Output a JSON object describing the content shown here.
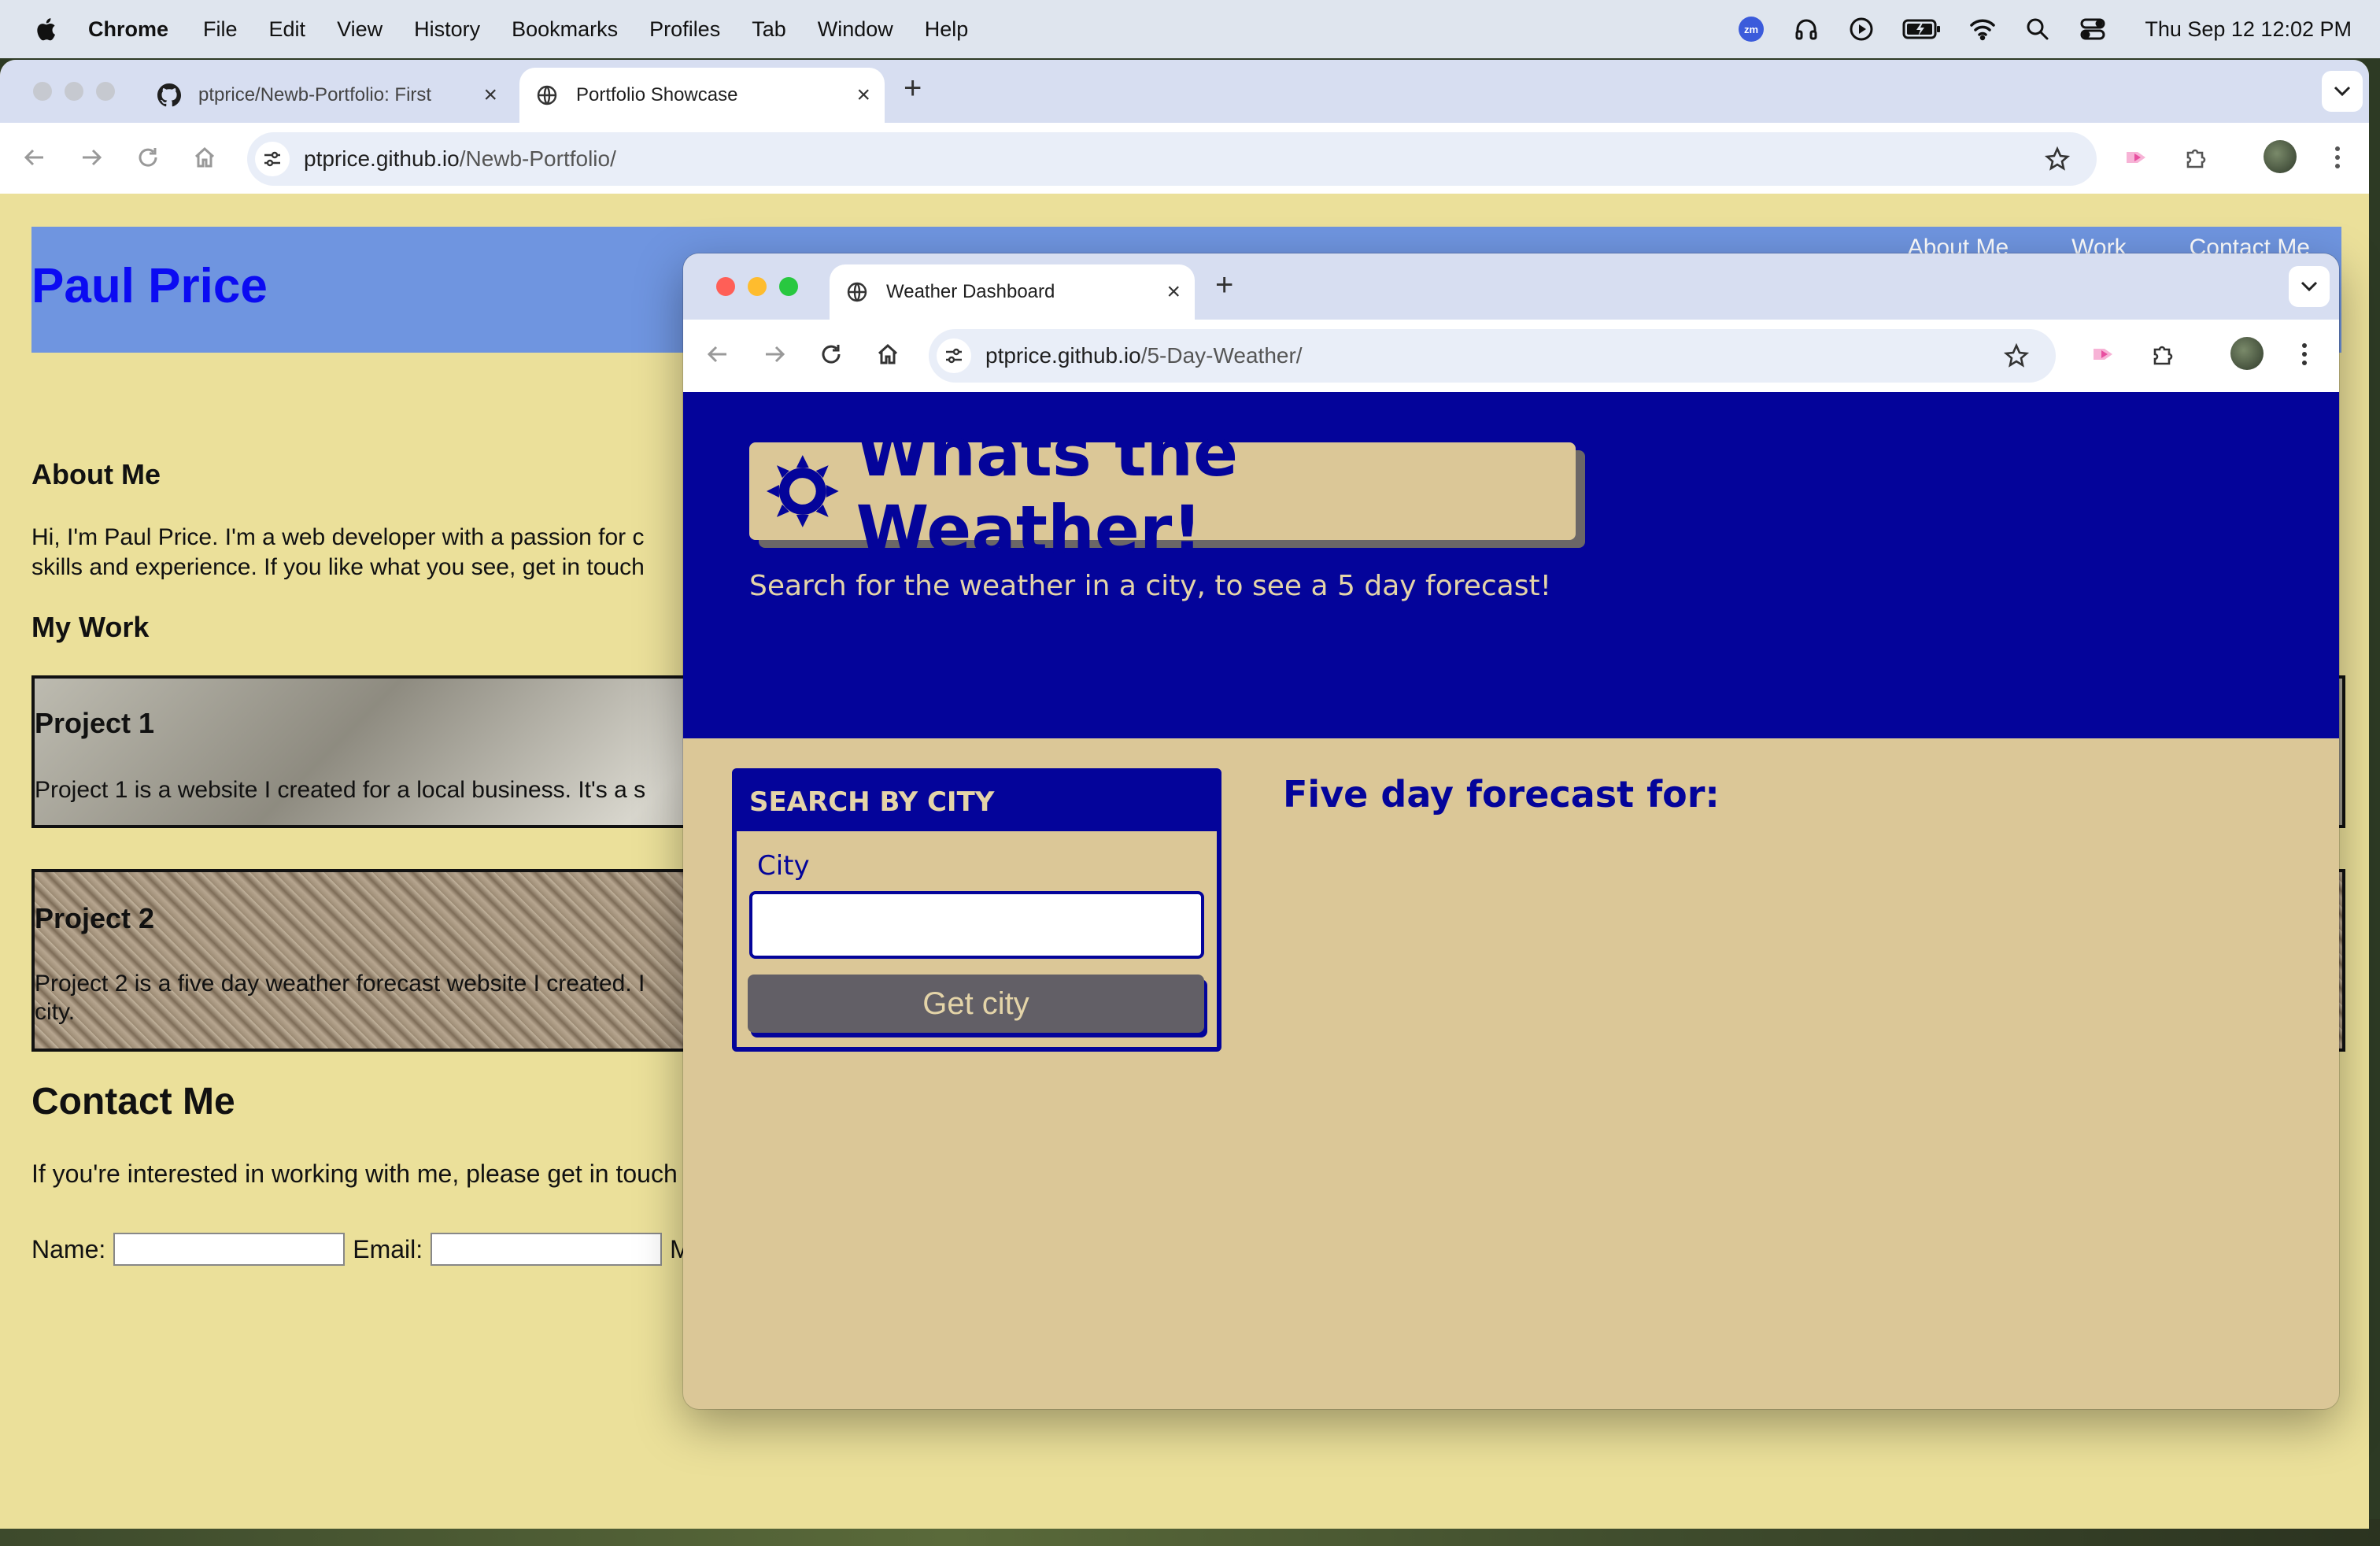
{
  "menubar": {
    "app": "Chrome",
    "items": [
      "File",
      "Edit",
      "View",
      "History",
      "Bookmarks",
      "Profiles",
      "Tab",
      "Window",
      "Help"
    ],
    "clock": "Thu Sep 12  12:02 PM",
    "status_icons": [
      "zoom-icon",
      "headphones-icon",
      "play-icon",
      "battery-icon",
      "wifi-icon",
      "search-icon",
      "control-center-icon"
    ]
  },
  "back_window": {
    "tabs": [
      {
        "title": "ptprice/Newb-Portfolio: First",
        "favicon": "github-icon"
      },
      {
        "title": "Portfolio Showcase",
        "favicon": "globe-icon"
      }
    ],
    "url_host": "ptprice.github.io",
    "url_path": "/Newb-Portfolio/",
    "page": {
      "name": "Paul Price",
      "nav": [
        "About Me",
        "Work",
        "Contact Me"
      ],
      "about_heading": "About Me",
      "about_line1": "Hi, I'm Paul Price. I'm a web developer with a passion for c",
      "about_line2": "skills and experience. If you like what you see, get in touch",
      "work_heading": "My Work",
      "projects": [
        {
          "title": "Project 1",
          "desc": "Project 1 is a website I created for a local business. It's a s"
        },
        {
          "title": "Project 2",
          "desc": "Project 2 is a five day weather forecast website I created. I",
          "desc2": "city."
        }
      ],
      "contact_heading": "Contact Me",
      "contact_text": "If you're interested in working with me, please get in touch",
      "form": {
        "name_label": "Name:",
        "email_label": "Email:",
        "message_label_partial": "M"
      }
    }
  },
  "front_window": {
    "tab": {
      "title": "Weather Dashboard",
      "favicon": "globe-icon"
    },
    "url_host": "ptprice.github.io",
    "url_path": "/5-Day-Weather/",
    "page": {
      "title": "Whats the Weather!",
      "subtitle": "Search for the weather in a city, to see a 5 day forecast!",
      "search_heading": "SEARCH BY CITY",
      "city_label": "City",
      "city_value": "",
      "button_label": "Get city",
      "forecast_heading": "Five day forecast for:"
    }
  },
  "colors": {
    "weather_navy": "#04049a",
    "weather_tan": "#dbc797",
    "portfolio_bg": "#ebe09a",
    "portfolio_header": "#6f95e0",
    "portfolio_name": "#0b0bf2"
  }
}
